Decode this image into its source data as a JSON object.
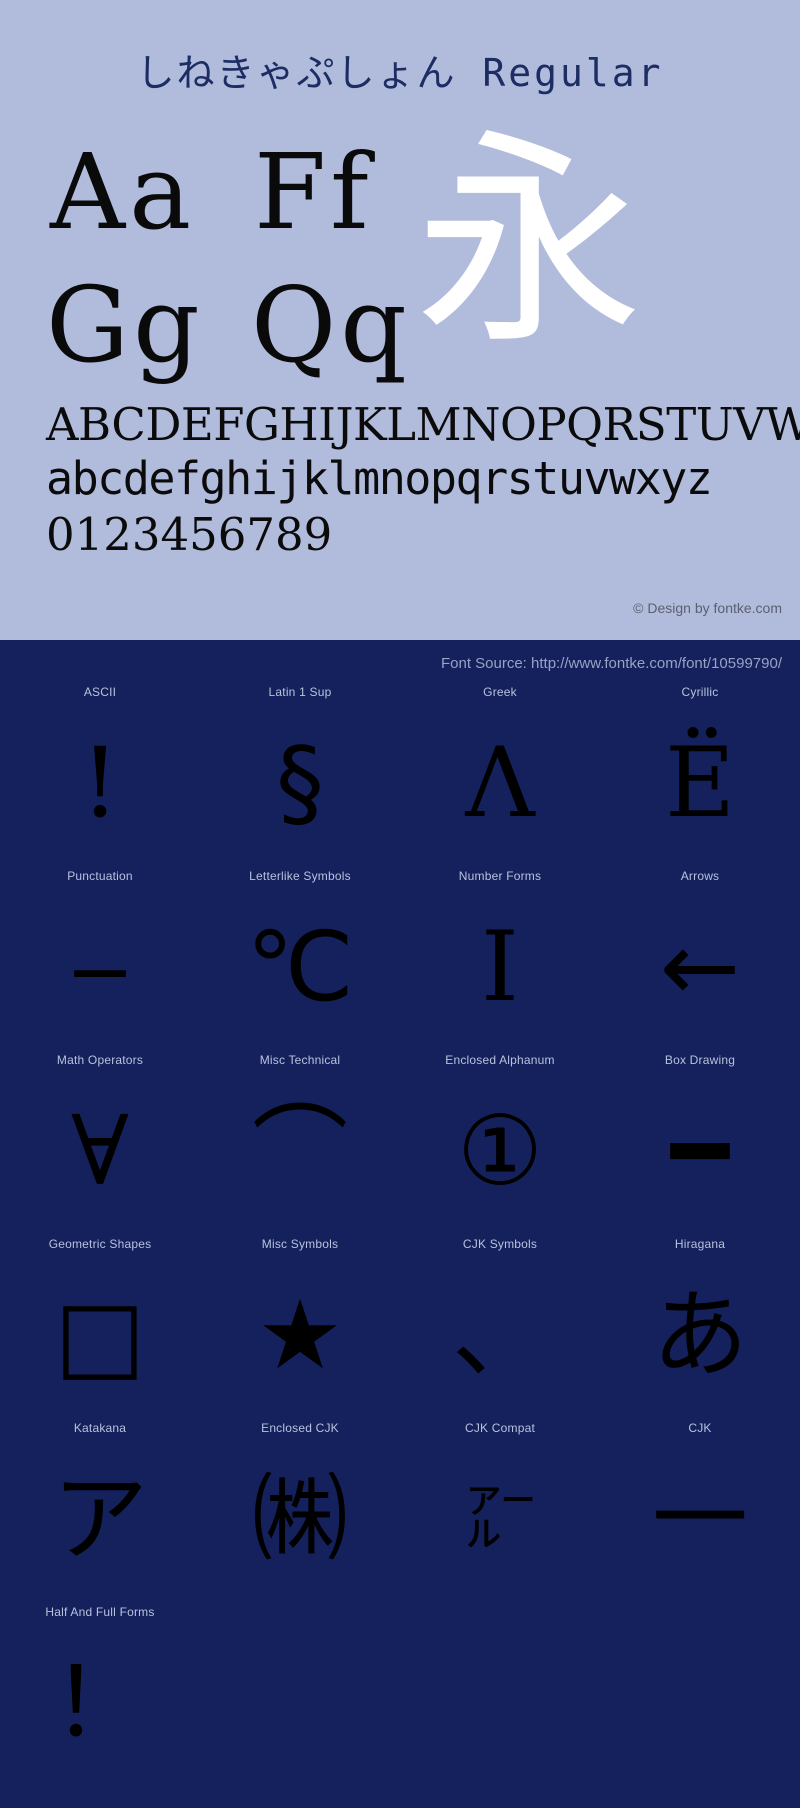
{
  "colors": {
    "specimen_bg": "#b1bcdd",
    "coverage_bg": "#14215c",
    "glyph_black": "#000000",
    "glyph_white": "#ffffff",
    "title_navy": "#1b2d63",
    "credit_gray": "#5a6070",
    "label_lavender": "#b9c2dd"
  },
  "specimen": {
    "title_jp": "しねきゃぷしょん",
    "title_style": "Regular",
    "pairs": [
      {
        "name": "aa",
        "text": "Aa"
      },
      {
        "name": "ff",
        "text": "Ff"
      },
      {
        "name": "gg",
        "text": "Gg"
      },
      {
        "name": "qq",
        "text": "Qq"
      }
    ],
    "cjk_showcase": "永",
    "uppercase": "ABCDEFGHIJKLMNOPQRSTUVWXYZ",
    "lowercase": "abcdefghijklmnopqrstuvwxyz",
    "digits": "0123456789",
    "credit": "© Design by fontke.com"
  },
  "coverage": {
    "source_line": "Font Source: http://www.fontke.com/font/10599790/",
    "rows": [
      [
        {
          "label": "ASCII",
          "glyph": "!",
          "style": "serifish"
        },
        {
          "label": "Latin 1 Sup",
          "glyph": "§",
          "style": ""
        },
        {
          "label": "Greek",
          "glyph": "Λ",
          "style": "serifish"
        },
        {
          "label": "Cyrillic",
          "glyph": "Ё",
          "style": "serifish"
        }
      ],
      [
        {
          "label": "Punctuation",
          "glyph": "‒",
          "style": ""
        },
        {
          "label": "Letterlike Symbols",
          "glyph": "℃",
          "style": ""
        },
        {
          "label": "Number Forms",
          "glyph": "Ⅰ",
          "style": "serifish"
        },
        {
          "label": "Arrows",
          "glyph": "←",
          "style": ""
        }
      ],
      [
        {
          "label": "Math Operators",
          "glyph": "∀",
          "style": "serifish"
        },
        {
          "label": "Misc Technical",
          "glyph": "⌒",
          "style": ""
        },
        {
          "label": "Enclosed Alphanum",
          "glyph": "①",
          "style": ""
        },
        {
          "label": "Box Drawing",
          "glyph": "━",
          "style": ""
        }
      ],
      [
        {
          "label": "Geometric Shapes",
          "glyph": "□",
          "style": ""
        },
        {
          "label": "Misc Symbols",
          "glyph": "★",
          "style": ""
        },
        {
          "label": "CJK Symbols",
          "glyph": "、",
          "style": ""
        },
        {
          "label": "Hiragana",
          "glyph": "あ",
          "style": ""
        }
      ],
      [
        {
          "label": "Katakana",
          "glyph": "ア",
          "style": ""
        },
        {
          "label": "Enclosed CJK",
          "glyph": "㈱",
          "style": ""
        },
        {
          "label": "CJK Compat",
          "glyph": "㌃",
          "style": "small"
        },
        {
          "label": "CJK",
          "glyph": "一",
          "style": ""
        }
      ],
      [
        {
          "label": "Half And Full Forms",
          "glyph": "！",
          "style": ""
        },
        {
          "label": "",
          "glyph": "",
          "style": ""
        },
        {
          "label": "",
          "glyph": "",
          "style": ""
        },
        {
          "label": "",
          "glyph": "",
          "style": ""
        }
      ]
    ]
  }
}
